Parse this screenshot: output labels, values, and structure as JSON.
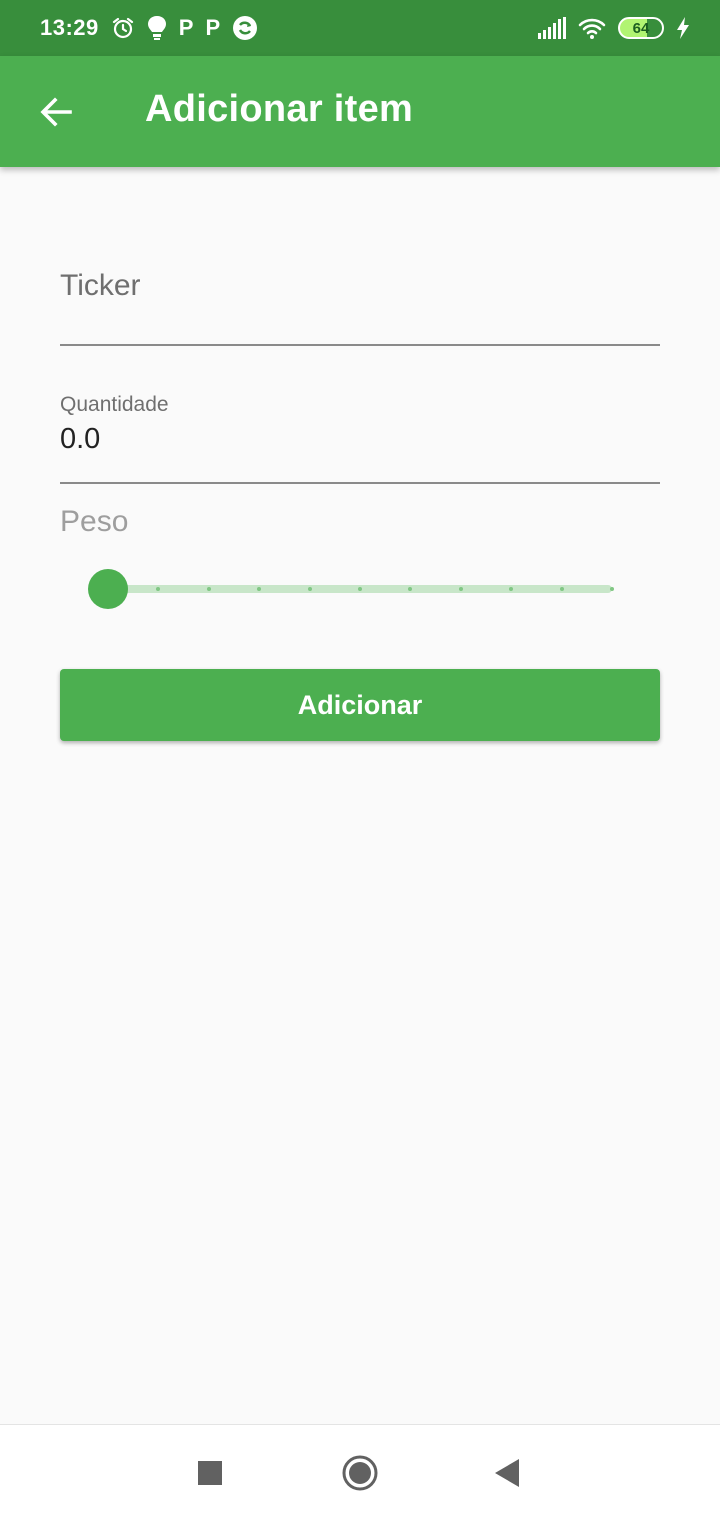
{
  "status_bar": {
    "time": "13:29",
    "battery_level": "64",
    "notification_icons": [
      "alarm-icon",
      "bulb-icon",
      "p-icon",
      "p-icon",
      "sync-icon"
    ],
    "p_glyph": "P",
    "system_icons": [
      "signal-icon",
      "wifi-icon",
      "battery-icon",
      "charging-icon"
    ]
  },
  "app_bar": {
    "title": "Adicionar item",
    "back_icon": "arrow-left-icon"
  },
  "form": {
    "ticker": {
      "label": "Ticker",
      "value": ""
    },
    "quantity": {
      "label": "Quantidade",
      "value": "0.0"
    },
    "weight": {
      "label": "Peso",
      "slider_value": 0,
      "slider_divisions": 10
    },
    "submit_label": "Adicionar"
  },
  "nav_bar": {
    "buttons": [
      "recents-icon",
      "home-icon",
      "back-icon"
    ]
  },
  "colors": {
    "primary": "#4caf50",
    "primary_dark": "#388e3c",
    "slider_track": "#c8e6c9",
    "background": "#fafafa"
  }
}
